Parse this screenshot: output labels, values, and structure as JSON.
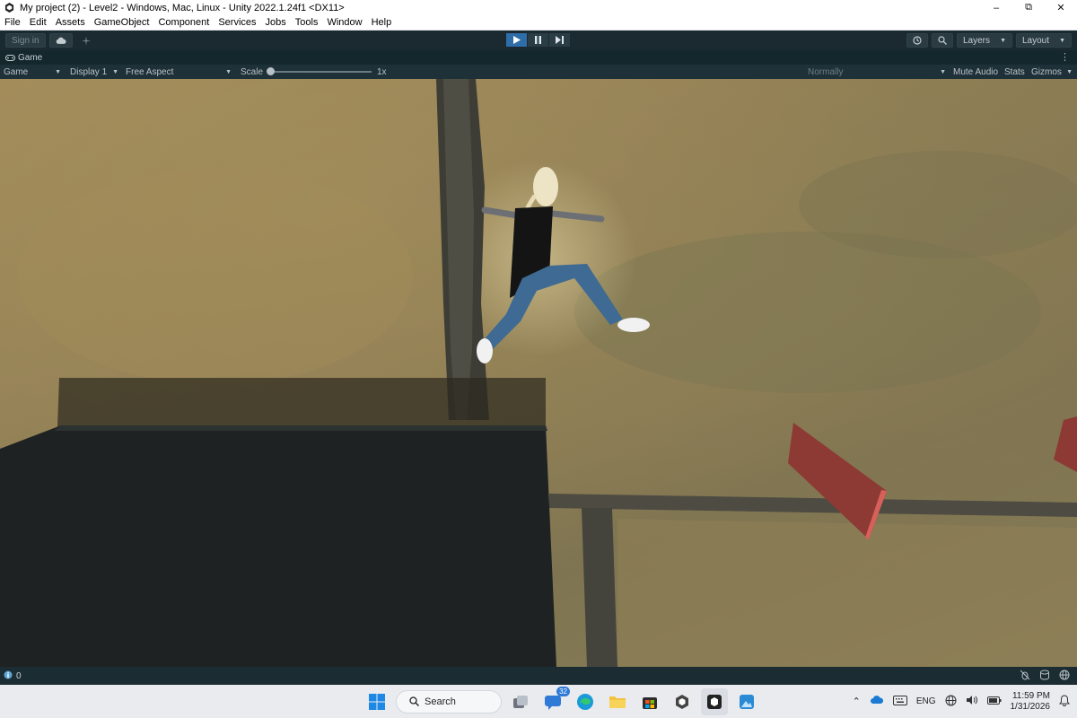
{
  "window": {
    "title": "My project (2) - Level2 - Windows, Mac, Linux - Unity 2022.1.24f1 <DX11>",
    "controls": [
      "minimize",
      "restore",
      "close"
    ]
  },
  "menu": [
    "File",
    "Edit",
    "Assets",
    "GameObject",
    "Component",
    "Services",
    "Jobs",
    "Tools",
    "Window",
    "Help"
  ],
  "toolbar": {
    "sign_in": "Sign in",
    "play_state": "playing",
    "layers": "Layers",
    "layout": "Layout"
  },
  "game_tab": {
    "label": "Game"
  },
  "game_toolbar": {
    "view": "Game",
    "display": "Display 1",
    "aspect": "Free Aspect",
    "scale_label": "Scale",
    "scale_value": "1x",
    "play_mode": "Normally",
    "mute": "Mute Audio",
    "stats": "Stats",
    "gizmos": "Gizmos"
  },
  "status": {
    "count": "0"
  },
  "taskbar": {
    "search": "Search",
    "badge": "32",
    "language": "ENG",
    "time": "11:59 PM",
    "date": "1/31/2026"
  },
  "colors": {
    "play_active": "#2e6da8",
    "toolbar_bg": "#1b2a30",
    "wall": "#8c3a33"
  }
}
